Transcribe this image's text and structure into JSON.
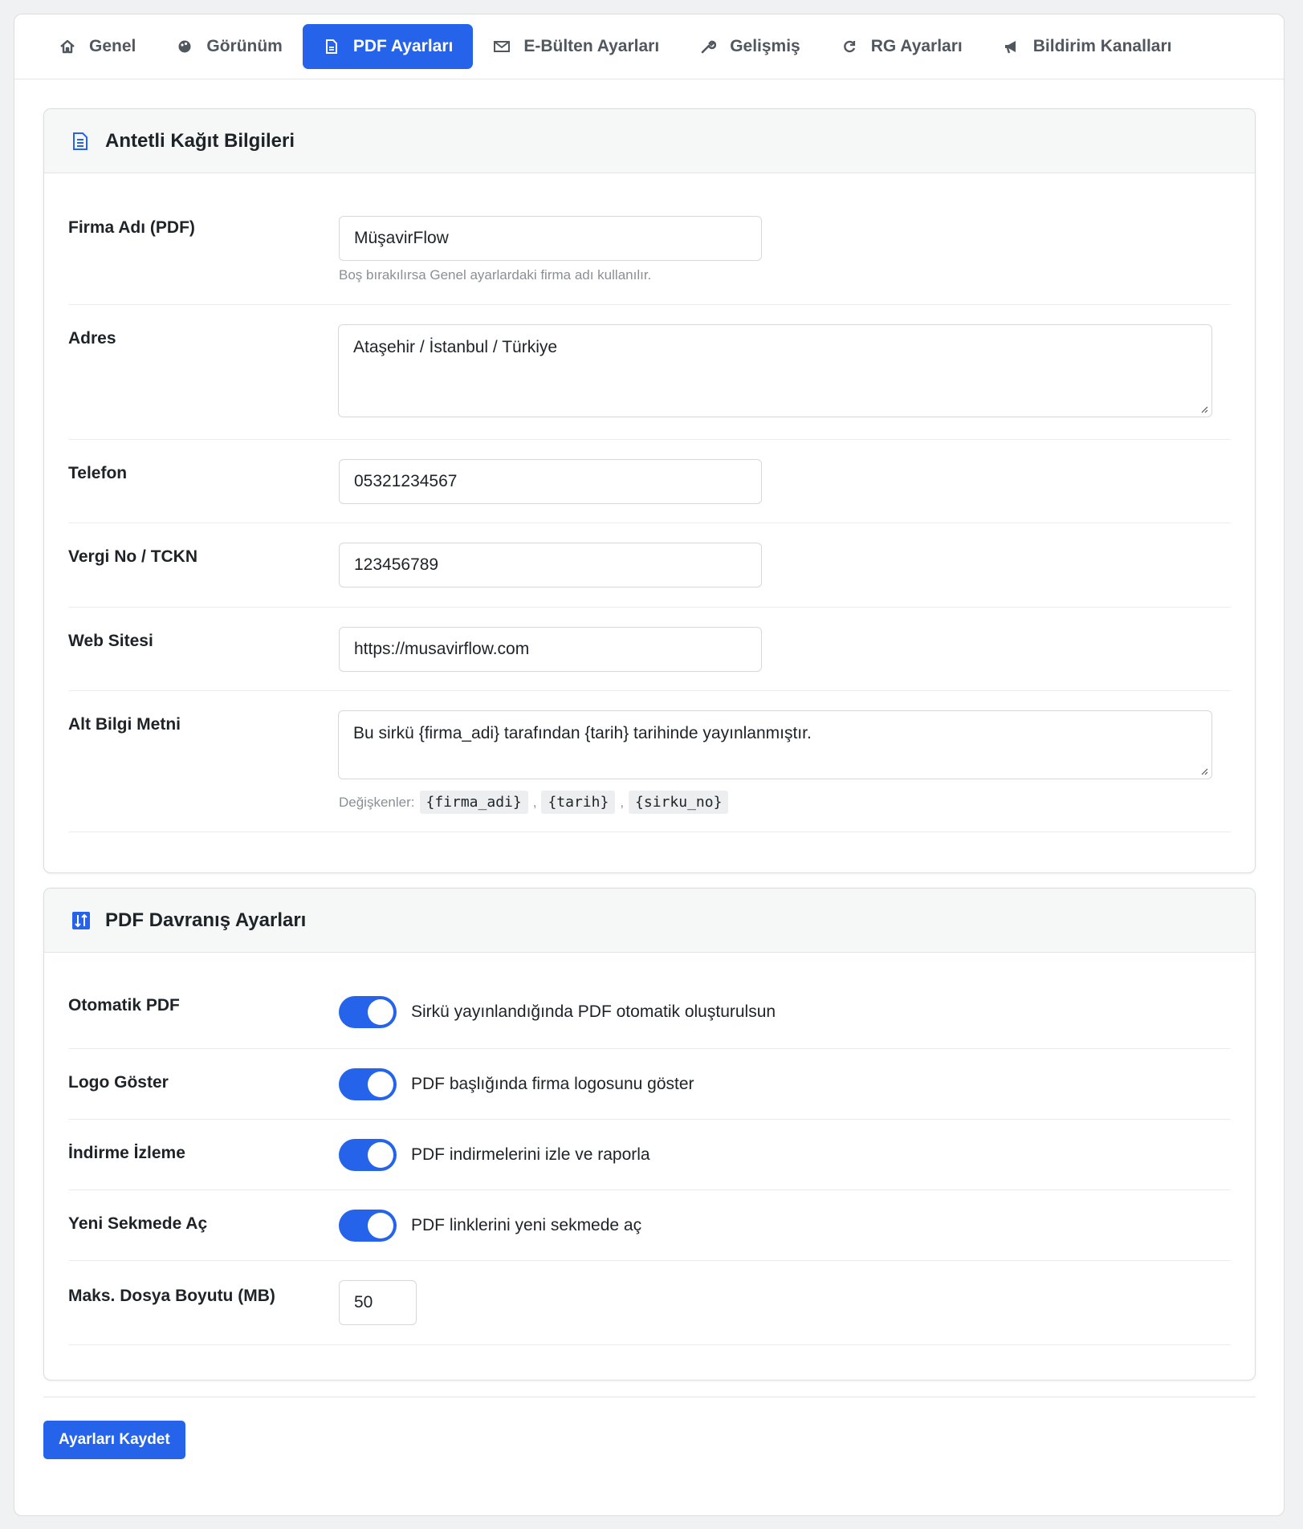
{
  "tabs": [
    {
      "label": "Genel",
      "icon": "home-icon"
    },
    {
      "label": "Görünüm",
      "icon": "palette-icon"
    },
    {
      "label": "PDF Ayarları",
      "icon": "pdf-document-icon",
      "active": true
    },
    {
      "label": "E-Bülten Ayarları",
      "icon": "envelope-icon"
    },
    {
      "label": "Gelişmiş",
      "icon": "wrench-icon"
    },
    {
      "label": "RG Ayarları",
      "icon": "refresh-icon"
    },
    {
      "label": "Bildirim Kanalları",
      "icon": "megaphone-icon"
    }
  ],
  "letterhead": {
    "title": "Antetli Kağıt Bilgileri",
    "company_label": "Firma Adı (PDF)",
    "company_value": "MüşavirFlow",
    "company_hint": "Boş bırakılırsa Genel ayarlardaki firma adı kullanılır.",
    "address_label": "Adres",
    "address_value": "Ataşehir / İstanbul / Türkiye",
    "phone_label": "Telefon",
    "phone_value": "05321234567",
    "tax_label": "Vergi No / TCKN",
    "tax_value": "123456789",
    "web_label": "Web Sitesi",
    "web_value": "https://musavirflow.com",
    "footer_label": "Alt Bilgi Metni",
    "footer_value": "Bu sirkü {firma_adi} tarafından {tarih} tarihinde yayınlanmıştır.",
    "vars_label": "Değişkenler:",
    "vars": [
      "{firma_adi}",
      "{tarih}",
      "{sirku_no}"
    ],
    "vars_sep": ","
  },
  "behavior": {
    "title": "PDF Davranış Ayarları",
    "auto_label": "Otomatik PDF",
    "auto_text": "Sirkü yayınlandığında PDF otomatik oluşturulsun",
    "auto_on": true,
    "logo_label": "Logo Göster",
    "logo_text": "PDF başlığında firma logosunu göster",
    "logo_on": true,
    "track_label": "İndirme İzleme",
    "track_text": "PDF indirmelerini izle ve raporla",
    "track_on": true,
    "newtab_label": "Yeni Sekmede Aç",
    "newtab_text": "PDF linklerini yeni sekmede aç",
    "newtab_on": true,
    "maxsize_label": "Maks. Dosya Boyutu (MB)",
    "maxsize_value": "50"
  },
  "save_label": "Ayarları Kaydet",
  "colors": {
    "accent": "#2563eb",
    "background": "#f0f1f3",
    "card_header": "#f6f7f7"
  }
}
